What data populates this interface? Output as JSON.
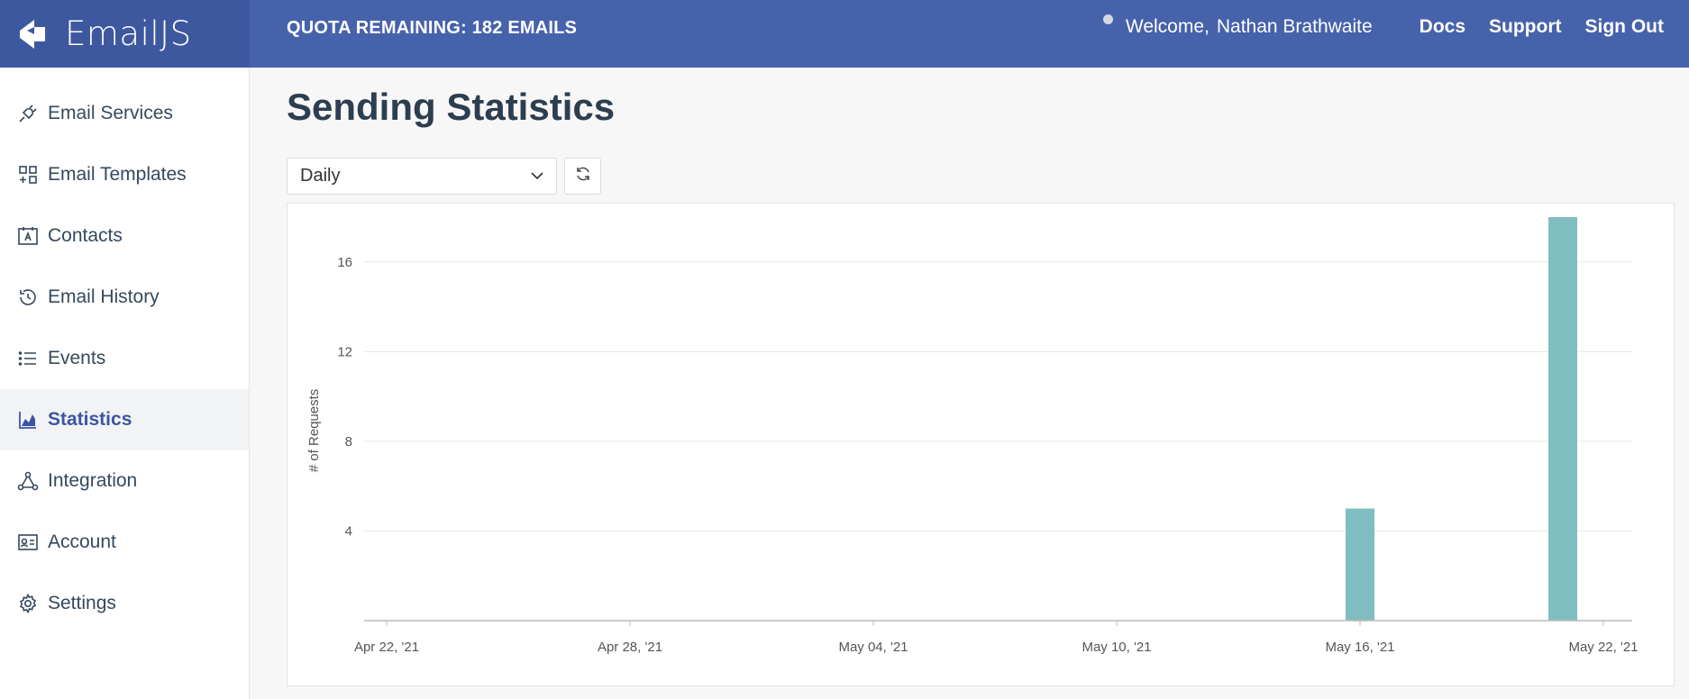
{
  "app": {
    "name": "EmailJS"
  },
  "header": {
    "quota": "QUOTA REMAINING: 182 EMAILS",
    "welcome": "Welcome,",
    "user_name": "Nathan Brathwaite",
    "links": [
      "Docs",
      "Support",
      "Sign Out"
    ]
  },
  "sidebar": {
    "items": [
      {
        "label": "Email Services",
        "icon": "plug-icon",
        "active": false
      },
      {
        "label": "Email Templates",
        "icon": "templates-icon",
        "active": false
      },
      {
        "label": "Contacts",
        "icon": "contacts-icon",
        "active": false
      },
      {
        "label": "Email History",
        "icon": "history-icon",
        "active": false
      },
      {
        "label": "Events",
        "icon": "list-icon",
        "active": false
      },
      {
        "label": "Statistics",
        "icon": "chart-icon",
        "active": true
      },
      {
        "label": "Integration",
        "icon": "integration-icon",
        "active": false
      },
      {
        "label": "Account",
        "icon": "account-icon",
        "active": false
      },
      {
        "label": "Settings",
        "icon": "gear-icon",
        "active": false
      }
    ]
  },
  "main": {
    "title": "Sending Statistics",
    "period_select": "Daily"
  },
  "colors": {
    "header": "#4662ab",
    "accent": "#3c55a3",
    "bar": "#80bdc1"
  },
  "chart_data": {
    "type": "bar",
    "ylabel": "# of Requests",
    "ylim": [
      0,
      18
    ],
    "yticks": [
      4,
      8,
      12,
      16
    ],
    "x_tick_labels": [
      "Apr 22, '21",
      "Apr 28, '21",
      "May 04, '21",
      "May 10, '21",
      "May 16, '21",
      "May 22, '21"
    ],
    "x_range": [
      "2021-04-22",
      "2021-05-22"
    ],
    "grid": true,
    "bars": [
      {
        "date": "2021-05-16",
        "value": 5
      },
      {
        "date": "2021-05-21",
        "value": 18
      }
    ]
  }
}
